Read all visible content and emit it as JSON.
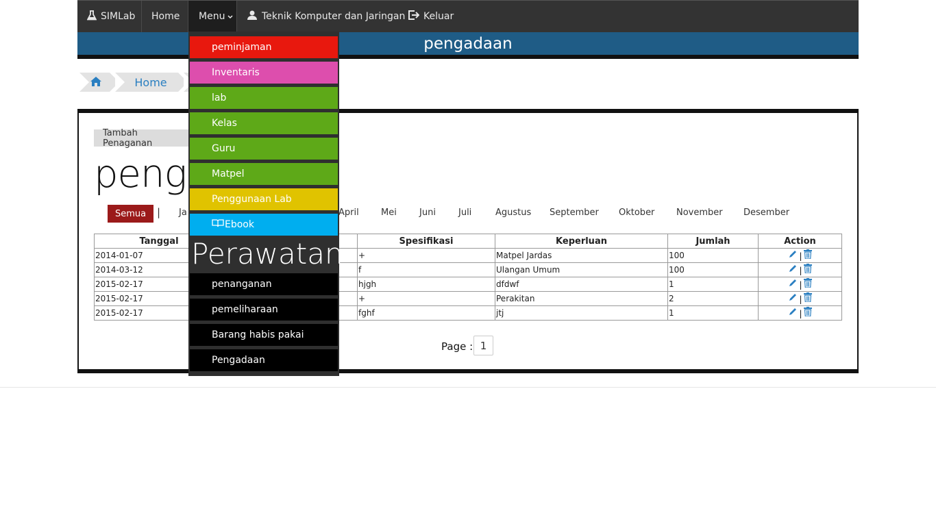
{
  "navbar": {
    "brand": "SIMLab",
    "home": "Home",
    "menu": "Menu",
    "user": "Teknik Komputer dan Jaringan",
    "logout": "Keluar"
  },
  "page": {
    "banner_title": "pengadaan",
    "heading": "penga",
    "add_button": "Tambah Penaganan"
  },
  "breadcrumb": {
    "home": "Home"
  },
  "months": {
    "all": "Semua",
    "pipe": "|",
    "items": [
      "Ja",
      "April",
      "Mei",
      "Juni",
      "Juli",
      "Agustus",
      "September",
      "Oktober",
      "November",
      "Desember"
    ]
  },
  "table": {
    "headers": [
      "Tanggal",
      "",
      "Spesifikasi",
      "Keperluan",
      "Jumlah",
      "Action"
    ],
    "rows": [
      [
        "2014-01-07",
        "",
        "+",
        "Matpel Jardas",
        "100"
      ],
      [
        "2014-03-12",
        "",
        "f",
        "Ulangan Umum",
        "100"
      ],
      [
        "2015-02-17",
        "",
        "hjgh",
        "dfdwf",
        "1"
      ],
      [
        "2015-02-17",
        "",
        "+",
        "Perakitan",
        "2"
      ],
      [
        "2015-02-17",
        "",
        "fghf",
        "jtj",
        "1"
      ]
    ],
    "action_sep": "|"
  },
  "pagination": {
    "label": "Page :",
    "current": "1"
  },
  "dropdown": {
    "items": [
      {
        "label": "peminjaman",
        "color": "#e8180e"
      },
      {
        "label": "Inventaris",
        "color": "#dd4ead"
      },
      {
        "label": "lab",
        "color": "#5ea918"
      },
      {
        "label": "Kelas",
        "color": "#5ea918"
      },
      {
        "label": "Guru",
        "color": "#5ea918"
      },
      {
        "label": "Matpel",
        "color": "#5ea918"
      },
      {
        "label": "Penggunaan Lab",
        "color": "#e0c300"
      },
      {
        "label": "Ebook",
        "color": "#00aeef"
      }
    ],
    "section_title": "Perawatan",
    "section_items": [
      {
        "label": "penanganan",
        "color": "#000000"
      },
      {
        "label": "pemeliharaan",
        "color": "#000000"
      },
      {
        "label": "Barang habis pakai",
        "color": "#000000"
      },
      {
        "label": "Pengadaan",
        "color": "#000000"
      }
    ]
  },
  "colors": {
    "navbar": "#333333",
    "banner": "#1f5c86",
    "filter_active": "#9b1a1a",
    "action_icon": "#2a7fc1"
  }
}
